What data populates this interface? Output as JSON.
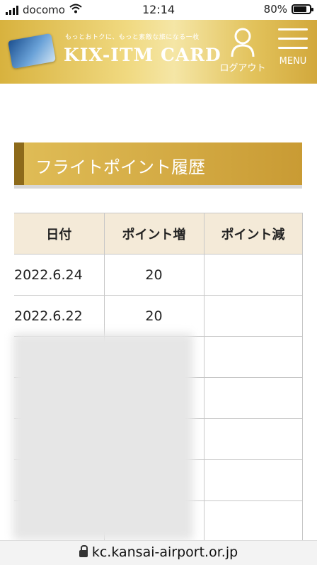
{
  "status_bar": {
    "carrier": "docomo",
    "time": "12:14",
    "battery": "80%"
  },
  "header": {
    "tagline": "もっとおトクに、もっと素敵な旅になる一枚",
    "brand": "KIX-ITM CARD",
    "logout_label": "ログアウト",
    "menu_label": "MENU"
  },
  "section": {
    "title": "フライトポイント履歴"
  },
  "table": {
    "headers": [
      "日付",
      "ポイント増",
      "ポイント減"
    ],
    "rows": [
      {
        "date": "2022.6.24",
        "plus": "20",
        "minus": ""
      },
      {
        "date": "2022.6.22",
        "plus": "20",
        "minus": ""
      }
    ]
  },
  "url_bar": {
    "url": "kc.kansai-airport.or.jp"
  },
  "colors": {
    "gold": "#d8b23e",
    "table_header": "#f4ead8",
    "heading_band": "#c99b34"
  }
}
